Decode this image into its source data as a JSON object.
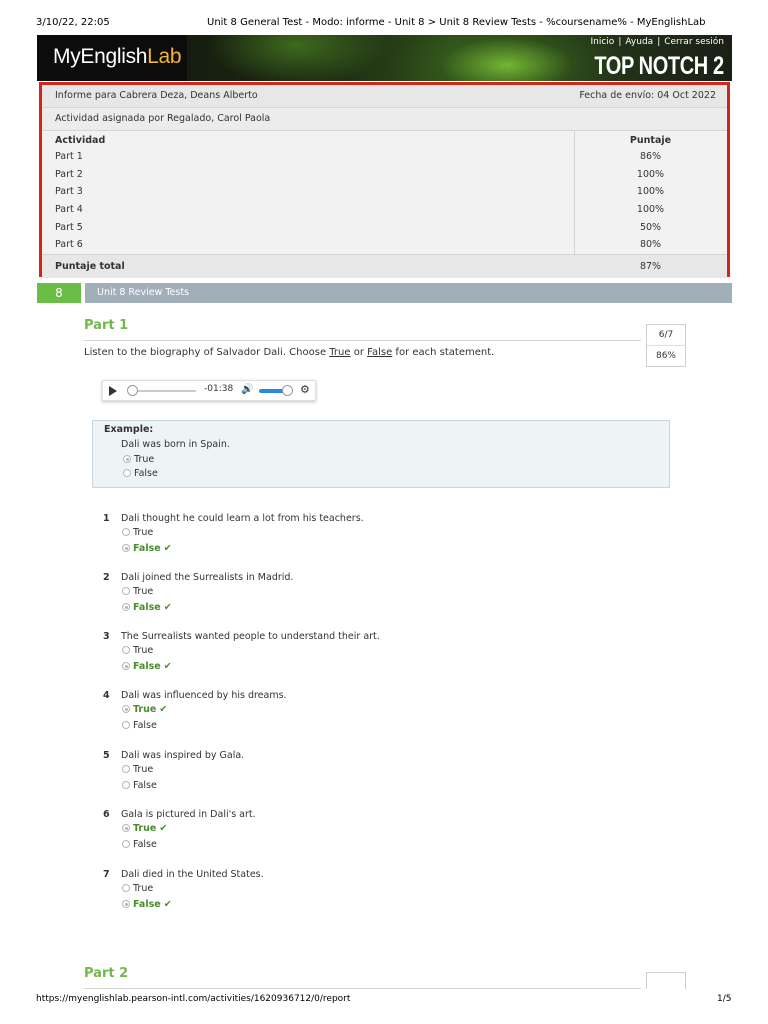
{
  "print": {
    "date": "3/10/22, 22:05",
    "title": "Unit 8 General Test - Modo: informe - Unit 8 > Unit 8 Review Tests - %coursename% - MyEnglishLab",
    "url": "https://myenglishlab.pearson-intl.com/activities/1620936712/0/report",
    "page": "1/5"
  },
  "header": {
    "logo_main": "MyEnglish",
    "logo_accent": "Lab",
    "links": [
      "Inicio",
      "Ayuda",
      "Cerrar sesión"
    ],
    "product": "TOP NOTCH  2"
  },
  "report": {
    "student": "Informe para Cabrera Deza, Deans Alberto",
    "submitted": "Fecha de envío: 04 Oct 2022",
    "assigned_by": "Actividad asignada por Regalado, Carol Paola",
    "col_activity": "Actividad",
    "col_score": "Puntaje",
    "rows": [
      {
        "activity": "Part 1",
        "score": "86%"
      },
      {
        "activity": "Part 2",
        "score": "100%"
      },
      {
        "activity": "Part 3",
        "score": "100%"
      },
      {
        "activity": "Part 4",
        "score": "100%"
      },
      {
        "activity": "Part 5",
        "score": "50%"
      },
      {
        "activity": "Part 6",
        "score": "80%"
      }
    ],
    "total_label": "Puntaje total",
    "total_score": "87%"
  },
  "unit": {
    "number": "8",
    "label": "Unit 8 Review Tests"
  },
  "part1": {
    "title": "Part 1",
    "score_fraction": "6/7",
    "score_percent": "86%",
    "instruction_pre": "Listen to the biography of Salvador Dali. Choose ",
    "instruction_true": "True",
    "instruction_mid": " or ",
    "instruction_false": "False",
    "instruction_post": " for each statement.",
    "player_time": "-01:38",
    "player_progress": 0.0,
    "player_volume": 0.85,
    "example": {
      "heading": "Example:",
      "statement": "Dali was born in Spain.",
      "opt_true": "True",
      "opt_false": "False"
    },
    "questions": [
      {
        "n": "1",
        "text": "Dali thought he could learn a lot from his teachers.",
        "opt1": "True",
        "opt2": "False",
        "answer": "False"
      },
      {
        "n": "2",
        "text": "Dali joined the Surrealists in Madrid.",
        "opt1": "True",
        "opt2": "False",
        "answer": "False"
      },
      {
        "n": "3",
        "text": "The Surrealists wanted people to understand their art.",
        "opt1": "True",
        "opt2": "False",
        "answer": "False"
      },
      {
        "n": "4",
        "text": "Dali was influenced by his dreams.",
        "opt1": "True",
        "opt2": "False",
        "answer": "True"
      },
      {
        "n": "5",
        "text": "Dali was inspired by Gala.",
        "opt1": "True",
        "opt2": "False",
        "answer": ""
      },
      {
        "n": "6",
        "text": "Gala is pictured in Dali's art.",
        "opt1": "True",
        "opt2": "False",
        "answer": "True"
      },
      {
        "n": "7",
        "text": "Dali died in the United States.",
        "opt1": "True",
        "opt2": "False",
        "answer": "False"
      }
    ]
  },
  "part2": {
    "title": "Part 2"
  }
}
